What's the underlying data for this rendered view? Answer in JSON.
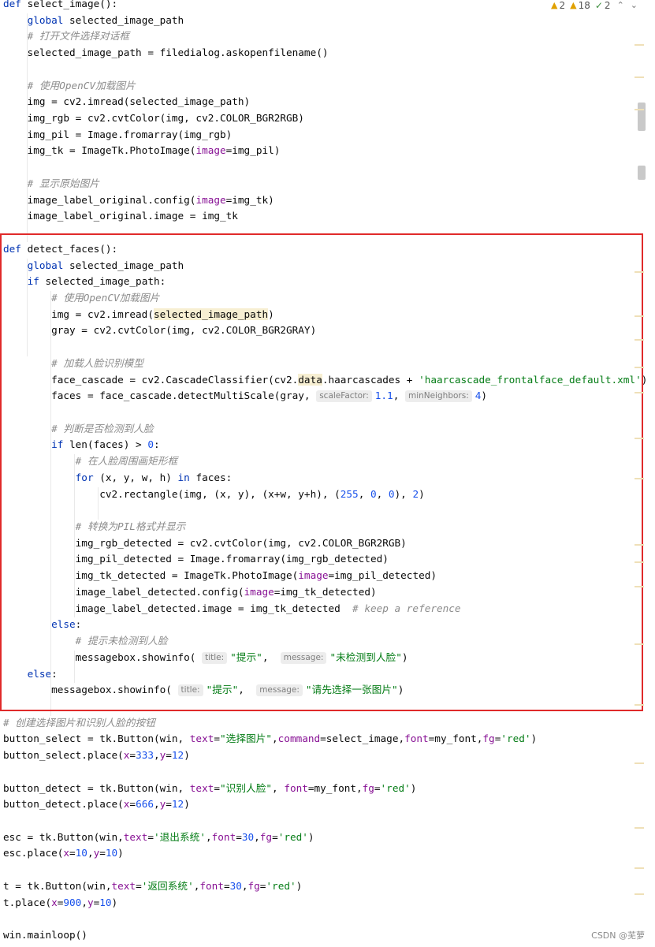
{
  "inspections": {
    "warnings_weak": "2",
    "warnings": "18",
    "typos": "2",
    "weak_color": "#e0a000",
    "ok_color": "#3e8f3e"
  },
  "watermark": "CSDN @芜萝",
  "highlight_box_color": "#e02a2a",
  "lines": [
    [
      [
        "kw",
        "def "
      ],
      [
        "fn",
        "select_image"
      ],
      [
        "p",
        "():"
      ]
    ],
    [
      [
        "p",
        "    "
      ],
      [
        "kw",
        "global "
      ],
      [
        "p",
        "selected_image_path"
      ]
    ],
    [
      [
        "p",
        "    "
      ],
      [
        "cmt",
        "# 打开文件选择对话框"
      ]
    ],
    [
      [
        "p",
        "    selected_image_path = filedialog.askopenfilename()"
      ]
    ],
    [],
    [
      [
        "p",
        "    "
      ],
      [
        "cmt",
        "# 使用OpenCV加载图片"
      ]
    ],
    [
      [
        "p",
        "    img = cv2.imread(selected_image_path)"
      ]
    ],
    [
      [
        "p",
        "    img_rgb = cv2.cvtColor(img, cv2.COLOR_BGR2RGB)"
      ]
    ],
    [
      [
        "p",
        "    img_pil = Image.fromarray(img_rgb)"
      ]
    ],
    [
      [
        "p",
        "    img_tk = ImageTk.PhotoImage("
      ],
      [
        "param",
        "image"
      ],
      [
        "p",
        "=img_pil)"
      ]
    ],
    [],
    [
      [
        "p",
        "    "
      ],
      [
        "cmt",
        "# 显示原始图片"
      ]
    ],
    [
      [
        "p",
        "    image_label_original.config("
      ],
      [
        "param",
        "image"
      ],
      [
        "p",
        "=img_tk)"
      ]
    ],
    [
      [
        "p",
        "    image_label_original.image = img_tk"
      ]
    ],
    [],
    [
      [
        "kw",
        "def "
      ],
      [
        "fn",
        "detect_faces"
      ],
      [
        "p",
        "():"
      ]
    ],
    [
      [
        "p",
        "    "
      ],
      [
        "kw",
        "global "
      ],
      [
        "p",
        "selected_image_path"
      ]
    ],
    [
      [
        "p",
        "    "
      ],
      [
        "kw",
        "if "
      ],
      [
        "p",
        "selected_image_path:"
      ]
    ],
    [
      [
        "p",
        "        "
      ],
      [
        "cmt",
        "# 使用OpenCV加载图片"
      ]
    ],
    [
      [
        "p",
        "        img = cv2.imread("
      ],
      [
        "hl",
        "selected_image_path"
      ],
      [
        "p",
        ")"
      ]
    ],
    [
      [
        "p",
        "        gray = cv2.cvtColor(img, cv2.COLOR_BGR2GRAY)"
      ]
    ],
    [],
    [
      [
        "p",
        "        "
      ],
      [
        "cmt",
        "# 加载人脸识别模型"
      ]
    ],
    [
      [
        "p",
        "        face_cascade = cv2.CascadeClassifier(cv2."
      ],
      [
        "hl",
        "data"
      ],
      [
        "p",
        ".haarcascades + "
      ],
      [
        "str",
        "'haarcascade_frontalface_default.xml'"
      ],
      [
        "p",
        ")"
      ]
    ],
    [
      [
        "p",
        "        faces = face_cascade.detectMultiScale(gray, "
      ],
      [
        "hint",
        "scaleFactor:"
      ],
      [
        "num",
        "1.1"
      ],
      [
        "p",
        ", "
      ],
      [
        "hint",
        "minNeighbors:"
      ],
      [
        "num",
        "4"
      ],
      [
        "p",
        ")"
      ]
    ],
    [],
    [
      [
        "p",
        "        "
      ],
      [
        "cmt",
        "# 判断是否检测到人脸"
      ]
    ],
    [
      [
        "p",
        "        "
      ],
      [
        "kw",
        "if "
      ],
      [
        "p",
        "len(faces) > "
      ],
      [
        "num",
        "0"
      ],
      [
        "p",
        ":"
      ]
    ],
    [
      [
        "p",
        "            "
      ],
      [
        "cmt",
        "# 在人脸周围画矩形框"
      ]
    ],
    [
      [
        "p",
        "            "
      ],
      [
        "kw",
        "for "
      ],
      [
        "p",
        "(x, y, w, h) "
      ],
      [
        "kw",
        "in "
      ],
      [
        "p",
        "faces:"
      ]
    ],
    [
      [
        "p",
        "                cv2.rectangle(img, (x, y), (x+w, y+h), ("
      ],
      [
        "num",
        "255"
      ],
      [
        "p",
        ", "
      ],
      [
        "num",
        "0"
      ],
      [
        "p",
        ", "
      ],
      [
        "num",
        "0"
      ],
      [
        "p",
        "), "
      ],
      [
        "num",
        "2"
      ],
      [
        "p",
        ")"
      ]
    ],
    [],
    [
      [
        "p",
        "            "
      ],
      [
        "cmt",
        "# 转换为PIL格式并显示"
      ]
    ],
    [
      [
        "p",
        "            img_rgb_detected = cv2.cvtColor(img, cv2.COLOR_BGR2RGB)"
      ]
    ],
    [
      [
        "p",
        "            img_pil_detected = Image.fromarray(img_rgb_detected)"
      ]
    ],
    [
      [
        "p",
        "            img_tk_detected = ImageTk.PhotoImage("
      ],
      [
        "param",
        "image"
      ],
      [
        "p",
        "=img_pil_detected)"
      ]
    ],
    [
      [
        "p",
        "            image_label_detected.config("
      ],
      [
        "param",
        "image"
      ],
      [
        "p",
        "=img_tk_detected)"
      ]
    ],
    [
      [
        "p",
        "            image_label_detected.image = img_tk_detected  "
      ],
      [
        "cmt",
        "# keep a reference"
      ]
    ],
    [
      [
        "p",
        "        "
      ],
      [
        "kw",
        "else"
      ],
      [
        "p",
        ":"
      ]
    ],
    [
      [
        "p",
        "            "
      ],
      [
        "cmt",
        "# 提示未检测到人脸"
      ]
    ],
    [
      [
        "p",
        "            messagebox.showinfo( "
      ],
      [
        "hint",
        "title:"
      ],
      [
        "str",
        "\"提示\""
      ],
      [
        "p",
        ",  "
      ],
      [
        "hint",
        "message:"
      ],
      [
        "str",
        "\"未检测到人脸\""
      ],
      [
        "p",
        ")"
      ]
    ],
    [
      [
        "p",
        "    "
      ],
      [
        "kw",
        "else"
      ],
      [
        "p",
        ":"
      ]
    ],
    [
      [
        "p",
        "        messagebox.showinfo( "
      ],
      [
        "hint",
        "title:"
      ],
      [
        "str",
        "\"提示\""
      ],
      [
        "p",
        ",  "
      ],
      [
        "hint",
        "message:"
      ],
      [
        "str",
        "\"请先选择一张图片\""
      ],
      [
        "p",
        ")"
      ]
    ],
    [],
    [
      [
        "cmt",
        "# 创建选择图片和识别人脸的按钮"
      ]
    ],
    [
      [
        "p",
        "button_select = tk.Button(win, "
      ],
      [
        "param",
        "text"
      ],
      [
        "p",
        "="
      ],
      [
        "str",
        "\"选择图片\""
      ],
      [
        "p",
        ","
      ],
      [
        "param",
        "command"
      ],
      [
        "p",
        "=select_image,"
      ],
      [
        "param",
        "font"
      ],
      [
        "p",
        "=my_font,"
      ],
      [
        "param",
        "fg"
      ],
      [
        "p",
        "="
      ],
      [
        "str",
        "'red'"
      ],
      [
        "p",
        ")"
      ]
    ],
    [
      [
        "p",
        "button_select.place("
      ],
      [
        "param",
        "x"
      ],
      [
        "p",
        "="
      ],
      [
        "num",
        "333"
      ],
      [
        "p",
        ","
      ],
      [
        "param",
        "y"
      ],
      [
        "p",
        "="
      ],
      [
        "num",
        "12"
      ],
      [
        "p",
        ")"
      ]
    ],
    [],
    [
      [
        "p",
        "button_detect = tk.Button(win, "
      ],
      [
        "param",
        "text"
      ],
      [
        "p",
        "="
      ],
      [
        "str",
        "\"识别人脸\""
      ],
      [
        "p",
        ", "
      ],
      [
        "param",
        "font"
      ],
      [
        "p",
        "=my_font,"
      ],
      [
        "param",
        "fg"
      ],
      [
        "p",
        "="
      ],
      [
        "str",
        "'red'"
      ],
      [
        "p",
        ")"
      ]
    ],
    [
      [
        "p",
        "button_detect.place("
      ],
      [
        "param",
        "x"
      ],
      [
        "p",
        "="
      ],
      [
        "num",
        "666"
      ],
      [
        "p",
        ","
      ],
      [
        "param",
        "y"
      ],
      [
        "p",
        "="
      ],
      [
        "num",
        "12"
      ],
      [
        "p",
        ")"
      ]
    ],
    [],
    [
      [
        "p",
        "esc = tk.Button(win,"
      ],
      [
        "param",
        "text"
      ],
      [
        "p",
        "="
      ],
      [
        "str",
        "'退出系统'"
      ],
      [
        "p",
        ","
      ],
      [
        "param",
        "font"
      ],
      [
        "p",
        "="
      ],
      [
        "num",
        "30"
      ],
      [
        "p",
        ","
      ],
      [
        "param",
        "fg"
      ],
      [
        "p",
        "="
      ],
      [
        "str",
        "'red'"
      ],
      [
        "p",
        ")"
      ]
    ],
    [
      [
        "p",
        "esc.place("
      ],
      [
        "param",
        "x"
      ],
      [
        "p",
        "="
      ],
      [
        "num",
        "10"
      ],
      [
        "p",
        ","
      ],
      [
        "param",
        "y"
      ],
      [
        "p",
        "="
      ],
      [
        "num",
        "10"
      ],
      [
        "p",
        ")"
      ]
    ],
    [],
    [
      [
        "p",
        "t = tk.Button(win,"
      ],
      [
        "param",
        "text"
      ],
      [
        "p",
        "="
      ],
      [
        "str",
        "'返回系统'"
      ],
      [
        "p",
        ","
      ],
      [
        "param",
        "font"
      ],
      [
        "p",
        "="
      ],
      [
        "num",
        "30"
      ],
      [
        "p",
        ","
      ],
      [
        "param",
        "fg"
      ],
      [
        "p",
        "="
      ],
      [
        "str",
        "'red'"
      ],
      [
        "p",
        ")"
      ]
    ],
    [
      [
        "p",
        "t.place("
      ],
      [
        "param",
        "x"
      ],
      [
        "p",
        "="
      ],
      [
        "num",
        "900"
      ],
      [
        "p",
        ","
      ],
      [
        "param",
        "y"
      ],
      [
        "p",
        "="
      ],
      [
        "num",
        "10"
      ],
      [
        "p",
        ")"
      ]
    ],
    [],
    [
      [
        "p",
        "win.mainloop()"
      ]
    ]
  ]
}
